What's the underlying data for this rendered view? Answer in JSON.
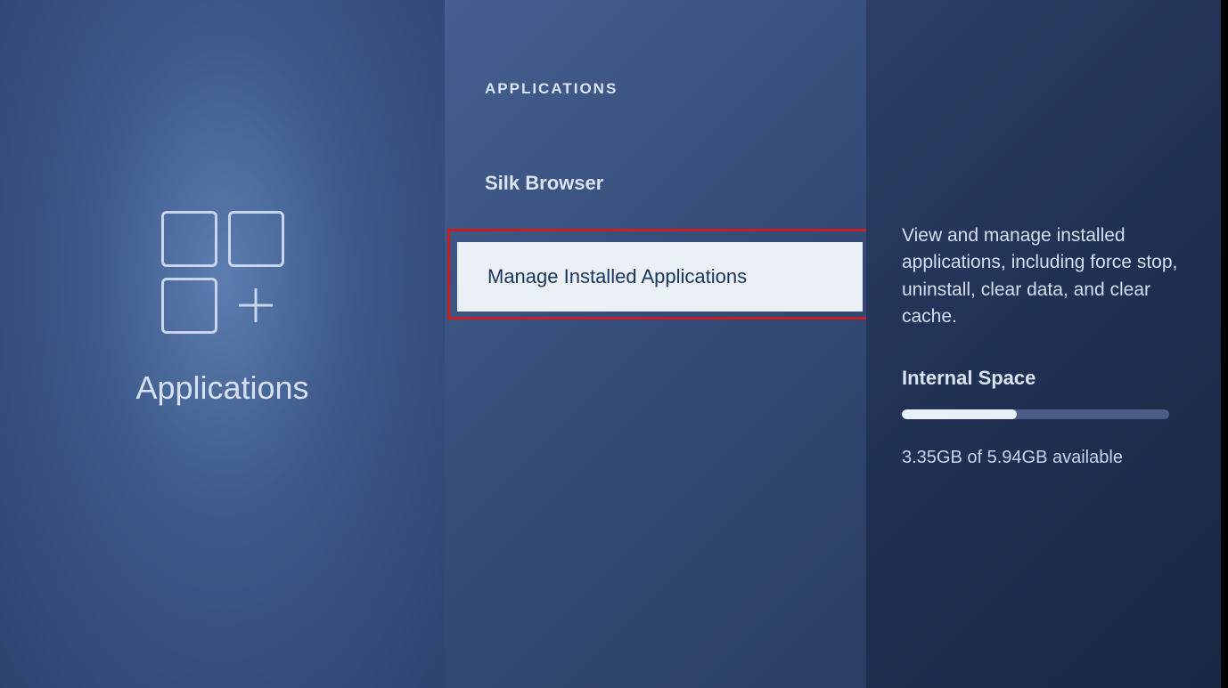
{
  "leftPanel": {
    "label": "Applications"
  },
  "middlePanel": {
    "header": "APPLICATIONS",
    "items": [
      {
        "label": "Silk Browser",
        "selected": false
      },
      {
        "label": "Manage Installed Applications",
        "selected": true
      }
    ]
  },
  "rightPanel": {
    "description": "View and manage installed applications, including force stop, uninstall, clear data, and clear cache.",
    "storageTitle": "Internal Space",
    "storageUsedPercent": 43,
    "storageInfo": "3.35GB of 5.94GB available"
  }
}
